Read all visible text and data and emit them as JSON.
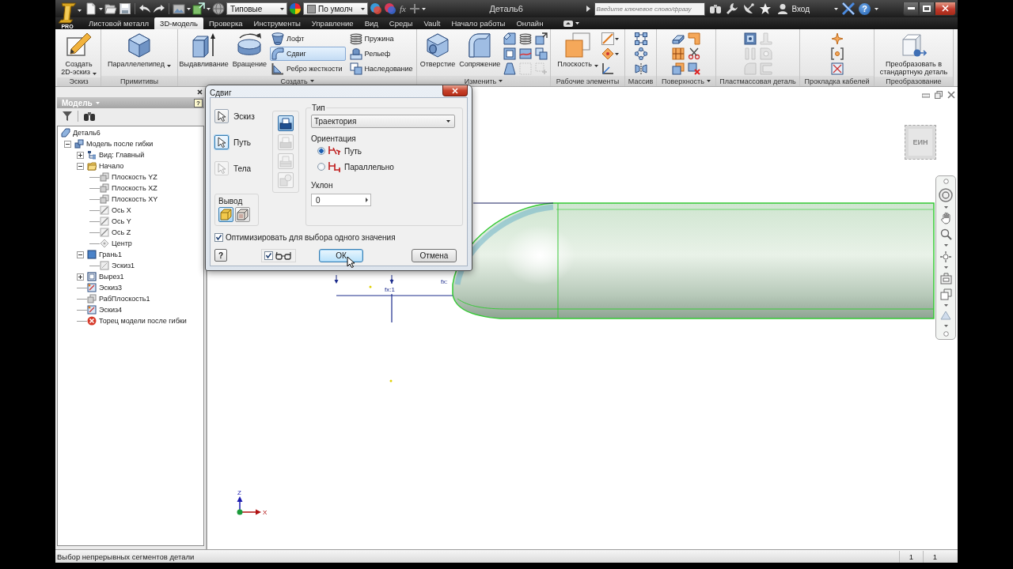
{
  "title_bar": {
    "app_badge": "PRO",
    "style_dropdown": "Типовые",
    "appearance_dropdown": "По умолч",
    "parameters_button": "fx",
    "title": "Деталь6",
    "search": {
      "placeholder": "Введите ключевое слово/фразу"
    },
    "sign_in": "Вход",
    "help": "?"
  },
  "tabs": [
    {
      "label": "Листовой металл",
      "selected": false
    },
    {
      "label": "3D-модель",
      "selected": true
    },
    {
      "label": "Проверка",
      "selected": false
    },
    {
      "label": "Инструменты",
      "selected": false
    },
    {
      "label": "Управление",
      "selected": false
    },
    {
      "label": "Вид",
      "selected": false
    },
    {
      "label": "Среды",
      "selected": false
    },
    {
      "label": "Vault",
      "selected": false
    },
    {
      "label": "Начало работы",
      "selected": false
    },
    {
      "label": "Онлайн",
      "selected": false
    }
  ],
  "ribbon": {
    "panels": [
      {
        "label": "Эскиз",
        "menu": false,
        "groups": [
          {
            "kind": "large",
            "label": "Создать 2D-эскиз",
            "dropdown": true
          }
        ]
      },
      {
        "label": "Примитивы",
        "menu": false,
        "groups": [
          {
            "kind": "large",
            "label": "Параллелепипед",
            "dropdown": true
          }
        ]
      },
      {
        "label": "Создать",
        "menu": true,
        "groups": [
          {
            "kind": "large",
            "label": "Выдавливание",
            "dropdown": false
          },
          {
            "kind": "large",
            "label": "Вращение",
            "dropdown": false
          },
          {
            "kind": "list",
            "tools": [
              {
                "label": "Лофт",
                "selected": false
              },
              {
                "label": "Сдвиг",
                "selected": true
              },
              {
                "label": "Ребро жесткости",
                "selected": false
              }
            ]
          },
          {
            "kind": "list",
            "tools": [
              {
                "label": "Пружина",
                "selected": false
              },
              {
                "label": "Рельеф",
                "selected": false
              },
              {
                "label": "Наследование",
                "selected": false
              }
            ]
          }
        ]
      },
      {
        "label": "Изменить",
        "menu": true,
        "groups": [
          {
            "kind": "large",
            "label": "Отверстие",
            "dropdown": false
          },
          {
            "kind": "large",
            "label": "Сопряжение",
            "dropdown": false
          },
          {
            "kind": "grid",
            "columns": [
              {
                "tools": [
                  {
                    "disabled": false
                  },
                  {
                    "disabled": false
                  },
                  {
                    "disabled": false
                  }
                ]
              },
              {
                "tools": [
                  {
                    "disabled": false
                  },
                  {
                    "disabled": false
                  },
                  {
                    "disabled": true
                  }
                ]
              },
              {
                "tools": [
                  {
                    "disabled": false
                  },
                  {
                    "disabled": false
                  },
                  {
                    "disabled": true
                  }
                ]
              }
            ]
          }
        ]
      },
      {
        "label": "Рабочие элементы",
        "menu": false,
        "groups": [
          {
            "kind": "large",
            "label": "Плоскость",
            "dropdown": true
          },
          {
            "kind": "grid",
            "columns": [
              {
                "tools": [
                  {
                    "disabled": false,
                    "dropdown": true
                  },
                  {
                    "disabled": false,
                    "dropdown": true
                  },
                  {
                    "disabled": false,
                    "dropdown": false
                  }
                ]
              }
            ]
          }
        ]
      },
      {
        "label": "Массив",
        "menu": false,
        "groups": [
          {
            "kind": "grid",
            "columns": [
              {
                "tools": [
                  {
                    "disabled": false
                  },
                  {
                    "disabled": false
                  },
                  {
                    "disabled": false
                  }
                ]
              }
            ]
          }
        ]
      },
      {
        "label": "Поверхность",
        "menu": true,
        "groups": [
          {
            "kind": "grid",
            "columns": [
              {
                "tools": [
                  {
                    "disabled": false
                  },
                  {
                    "disabled": false
                  },
                  {
                    "disabled": false
                  }
                ]
              },
              {
                "tools": [
                  {
                    "disabled": false
                  },
                  {
                    "disabled": false
                  },
                  {
                    "disabled": false
                  }
                ]
              }
            ]
          }
        ]
      },
      {
        "label": "Пластмассовая деталь",
        "menu": false,
        "groups": [
          {
            "kind": "grid",
            "columns": [
              {
                "tools": [
                  {
                    "disabled": false
                  },
                  {
                    "disabled": true
                  },
                  {
                    "disabled": true
                  }
                ]
              },
              {
                "tools": [
                  {
                    "disabled": true
                  },
                  {
                    "disabled": true
                  },
                  {
                    "disabled": true
                  }
                ]
              }
            ]
          }
        ]
      },
      {
        "label": "Прокладка кабелей",
        "menu": false,
        "groups": [
          {
            "kind": "grid",
            "columns": [
              {
                "tools": [
                  {
                    "disabled": false
                  },
                  {
                    "disabled": false
                  },
                  {
                    "disabled": false
                  }
                ]
              }
            ]
          }
        ]
      },
      {
        "label": "Преобразование",
        "menu": false,
        "groups": [
          {
            "kind": "large",
            "label": "Преобразовать в стандартную деталь",
            "dropdown": false
          }
        ]
      }
    ]
  },
  "browser": {
    "title": "Модель",
    "help": "?",
    "tree": [
      {
        "label": "Деталь6",
        "kind": "part",
        "children": [
          {
            "label": "Модель после гибки",
            "kind": "model",
            "expanded": true,
            "children": [
              {
                "label": "Вид: Главный",
                "kind": "view",
                "expanded": false
              },
              {
                "label": "Начало",
                "kind": "folder",
                "expanded": true,
                "children": [
                  {
                    "label": "Плоскость YZ",
                    "kind": "plane"
                  },
                  {
                    "label": "Плоскость XZ",
                    "kind": "plane"
                  },
                  {
                    "label": "Плоскость XY",
                    "kind": "plane"
                  },
                  {
                    "label": "Ось X",
                    "kind": "axis"
                  },
                  {
                    "label": "Ось Y",
                    "kind": "axis"
                  },
                  {
                    "label": "Ось Z",
                    "kind": "axis"
                  },
                  {
                    "label": "Центр",
                    "kind": "point"
                  }
                ]
              },
              {
                "label": "Грань1",
                "kind": "face",
                "expanded": true,
                "children": [
                  {
                    "label": "Эскиз1",
                    "kind": "consumed"
                  }
                ]
              },
              {
                "label": "Вырез1",
                "kind": "cut",
                "expanded": false
              },
              {
                "label": "Эскиз3",
                "kind": "sketch"
              },
              {
                "label": "РабПлоскость1",
                "kind": "workplane"
              },
              {
                "label": "Эскиз4",
                "kind": "sketch"
              },
              {
                "label": "Торец модели после гибки",
                "kind": "error"
              }
            ]
          }
        ]
      }
    ]
  },
  "dialog": {
    "title": "Сдвиг",
    "selectors": [
      {
        "label": "Эскиз",
        "selected": false,
        "disabled": false
      },
      {
        "label": "Путь",
        "selected": true,
        "disabled": false
      },
      {
        "label": "Тела",
        "selected": false,
        "disabled": true
      }
    ],
    "solid_options": [
      {
        "selected": true,
        "disabled": false
      },
      {
        "selected": false,
        "disabled": true
      },
      {
        "selected": false,
        "disabled": true
      },
      {
        "selected": false,
        "disabled": true
      }
    ],
    "output": {
      "label": "Вывод",
      "options": [
        {
          "selected": true
        },
        {
          "selected": false
        }
      ]
    },
    "type": {
      "label": "Тип",
      "value": "Траектория"
    },
    "orientation": {
      "label": "Ориентация",
      "options": [
        {
          "label": "Путь",
          "selected": true
        },
        {
          "label": "Параллельно",
          "selected": false
        }
      ]
    },
    "taper": {
      "label": "Уклон",
      "value": "0"
    },
    "optimize": {
      "label": "Оптимизировать для выбора одного значения",
      "checked": true
    },
    "help": "?",
    "preview": {
      "checked": true
    },
    "buttons": [
      {
        "label": "ОК",
        "kind": "primary"
      },
      {
        "label": "Отмена",
        "kind": "secondary"
      }
    ]
  },
  "canvas": {
    "dimension_labels": [
      "fx:1",
      "fx:"
    ],
    "viewcube_label": "ЕИН",
    "triad": {
      "z_label": "Z",
      "x_label": "X"
    }
  },
  "status_bar": {
    "message": "Выбор непрерывных сегментов детали",
    "fields": [
      "1",
      "1"
    ]
  }
}
